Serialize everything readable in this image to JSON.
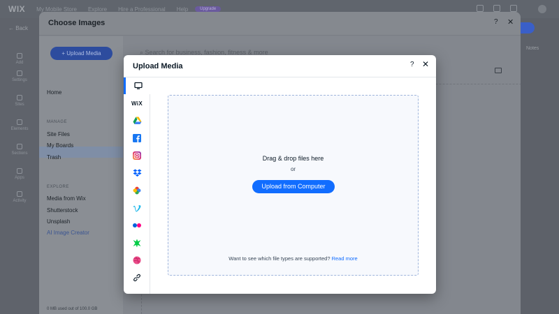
{
  "topbar": {
    "logo": "WIX",
    "site_name": "My Mobile Store",
    "items": [
      "Explore",
      "Hire a Professional",
      "Help"
    ],
    "upgrade": "Upgrade"
  },
  "leftbar": {
    "back": "Back",
    "items": [
      "Add",
      "Settings",
      "Sites",
      "Elements",
      "Sections",
      "Apps",
      "Activity"
    ]
  },
  "right_strip": {
    "notes": "Notes"
  },
  "choose_images": {
    "title": "Choose Images",
    "help": "?",
    "close": "✕",
    "upload_button": "+ Upload Media",
    "home": "Home",
    "manage_header": "MANAGE",
    "manage_items": [
      "Site Files",
      "My Boards",
      "Trash"
    ],
    "explore_header": "EXPLORE",
    "explore_items": [
      "Media from Wix",
      "Shutterstock",
      "Unsplash",
      "AI Image Creator"
    ],
    "search_placeholder": "Search for business, fashion, fitness & more",
    "storage": "0 MB used out of 100.0 GB"
  },
  "upload_media": {
    "title": "Upload Media",
    "help": "?",
    "close": "✕",
    "sources": [
      {
        "name": "My Computer",
        "icon": "monitor-icon"
      },
      {
        "name": "Wix",
        "icon": "wix-icon",
        "label": "WiX"
      },
      {
        "name": "Google Drive",
        "icon": "google-drive-icon"
      },
      {
        "name": "Facebook",
        "icon": "facebook-icon"
      },
      {
        "name": "Instagram",
        "icon": "instagram-icon"
      },
      {
        "name": "Dropbox",
        "icon": "dropbox-icon"
      },
      {
        "name": "Google Photos",
        "icon": "google-photos-icon"
      },
      {
        "name": "Vimeo",
        "icon": "vimeo-icon"
      },
      {
        "name": "Flickr",
        "icon": "flickr-icon"
      },
      {
        "name": "Deviantart",
        "icon": "deviantart-icon"
      },
      {
        "name": "Dribbble",
        "icon": "dribbble-icon"
      },
      {
        "name": "Link",
        "icon": "link-icon"
      }
    ],
    "drop_text": "Drag & drop files here",
    "or_text": "or",
    "upload_button": "Upload from Computer",
    "footer_text": "Want to see which file types are supported?",
    "footer_link": "Read more"
  },
  "colors": {
    "accent": "#116dff",
    "overlay": "#5c6068",
    "dialog_bg": "#ffffff",
    "dropzone_border": "#9fb5dc"
  }
}
